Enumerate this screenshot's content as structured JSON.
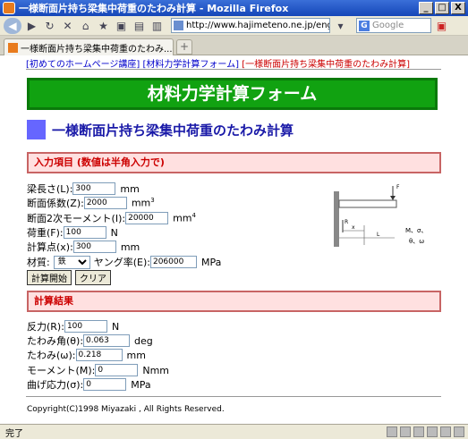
{
  "window": {
    "title": "一様断面片持ち梁集中荷重のたわみ計算 - Mozilla Firefox",
    "min": "_",
    "max": "□",
    "close": "X"
  },
  "nav": {
    "url": "http://www.hajimeteno.ne.jp/eng",
    "search_placeholder": "Google"
  },
  "tab": {
    "label": "一様断面片持ち梁集中荷重のたわみ...",
    "close": "x",
    "newtab": "+"
  },
  "breadcrumb": {
    "home": "[初めてのホームページ講座]",
    "form": "[材料力学計算フォーム]",
    "current": "[一様断面片持ち梁集中荷重のたわみ計算]"
  },
  "banner": "材料力学計算フォーム",
  "subtitle": "一様断面片持ち梁集中荷重のたわみ計算",
  "input_section": "入力項目 (数値は半角入力で)",
  "inputs": {
    "length_label": "梁長さ(L):",
    "length_value": "300",
    "length_unit": "mm",
    "modulus_label": "断面係数(Z):",
    "modulus_value": "2000",
    "modulus_unit": "mm",
    "modulus_exp": "3",
    "inertia_label": "断面2次モーメント(I):",
    "inertia_value": "20000",
    "inertia_unit": "mm",
    "inertia_exp": "4",
    "load_label": "荷重(F):",
    "load_value": "100",
    "load_unit": "N",
    "point_label": "計算点(x):",
    "point_value": "300",
    "point_unit": "mm",
    "material_label": "材質:",
    "material_value": "鉄",
    "young_label": "ヤング率(E):",
    "young_value": "206000",
    "young_unit": "MPa",
    "calc_button": "計算開始",
    "clear_button": "クリア"
  },
  "diagram": {
    "F": "F",
    "R": "R",
    "x": "x",
    "L": "L",
    "M": "M、σ、",
    "theta": "θ、ω"
  },
  "result_section": "計算結果",
  "results": {
    "reaction_label": "反力(R):",
    "reaction_value": "100",
    "reaction_unit": "N",
    "angle_label": "たわみ角(θ):",
    "angle_value": "0.063",
    "angle_unit": "deg",
    "deflection_label": "たわみ(ω):",
    "deflection_value": "0.218",
    "deflection_unit": "mm",
    "moment_label": "モーメント(M):",
    "moment_value": "0",
    "moment_unit": "Nmm",
    "stress_label": "曲げ応力(σ):",
    "stress_value": "0",
    "stress_unit": "MPa"
  },
  "copyright": "Copyright(C)1998 Miyazaki , All Rights Reserved.",
  "status": "完了"
}
